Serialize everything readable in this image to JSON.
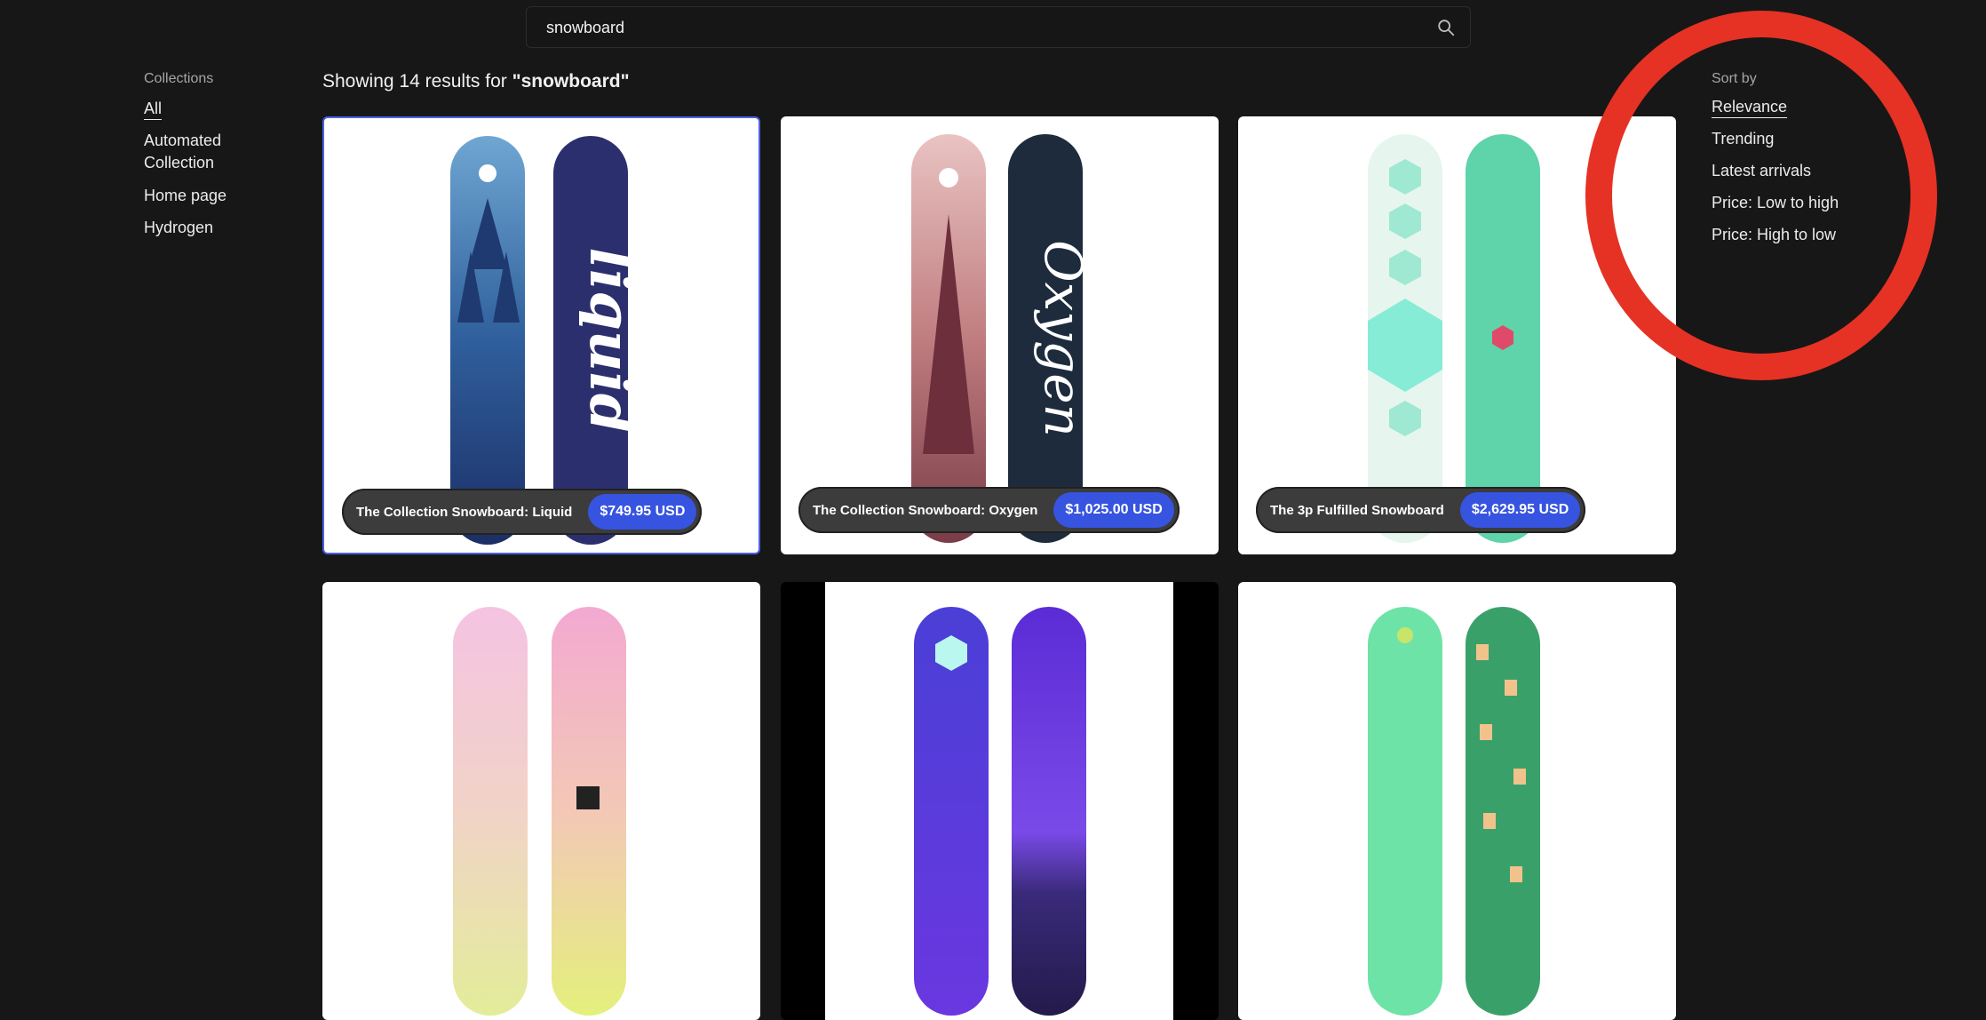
{
  "search": {
    "value": "snowboard",
    "placeholder": "Search"
  },
  "collections": {
    "heading": "Collections",
    "items": [
      {
        "label": "All",
        "active": true
      },
      {
        "label": "Automated\nCollection"
      },
      {
        "label": "Home page"
      },
      {
        "label": "Hydrogen"
      }
    ]
  },
  "results": {
    "prefix": "Showing 14 results for",
    "query": "\"snowboard\""
  },
  "products": [
    {
      "name": "The Collection Snowboard: Liquid",
      "price": "$749.95 USD"
    },
    {
      "name": "The Collection Snowboard: Oxygen",
      "price": "$1,025.00 USD"
    },
    {
      "name": "The 3p Fulfilled Snowboard",
      "price": "$2,629.95 USD"
    }
  ],
  "sort": {
    "heading": "Sort by",
    "items": [
      {
        "label": "Relevance",
        "active": true
      },
      {
        "label": "Trending"
      },
      {
        "label": "Latest arrivals"
      },
      {
        "label": "Price: Low to high"
      },
      {
        "label": "Price: High to low"
      }
    ]
  },
  "colors": {
    "accent": "#3654e0",
    "annotation": "#e53224",
    "background": "#171717"
  }
}
